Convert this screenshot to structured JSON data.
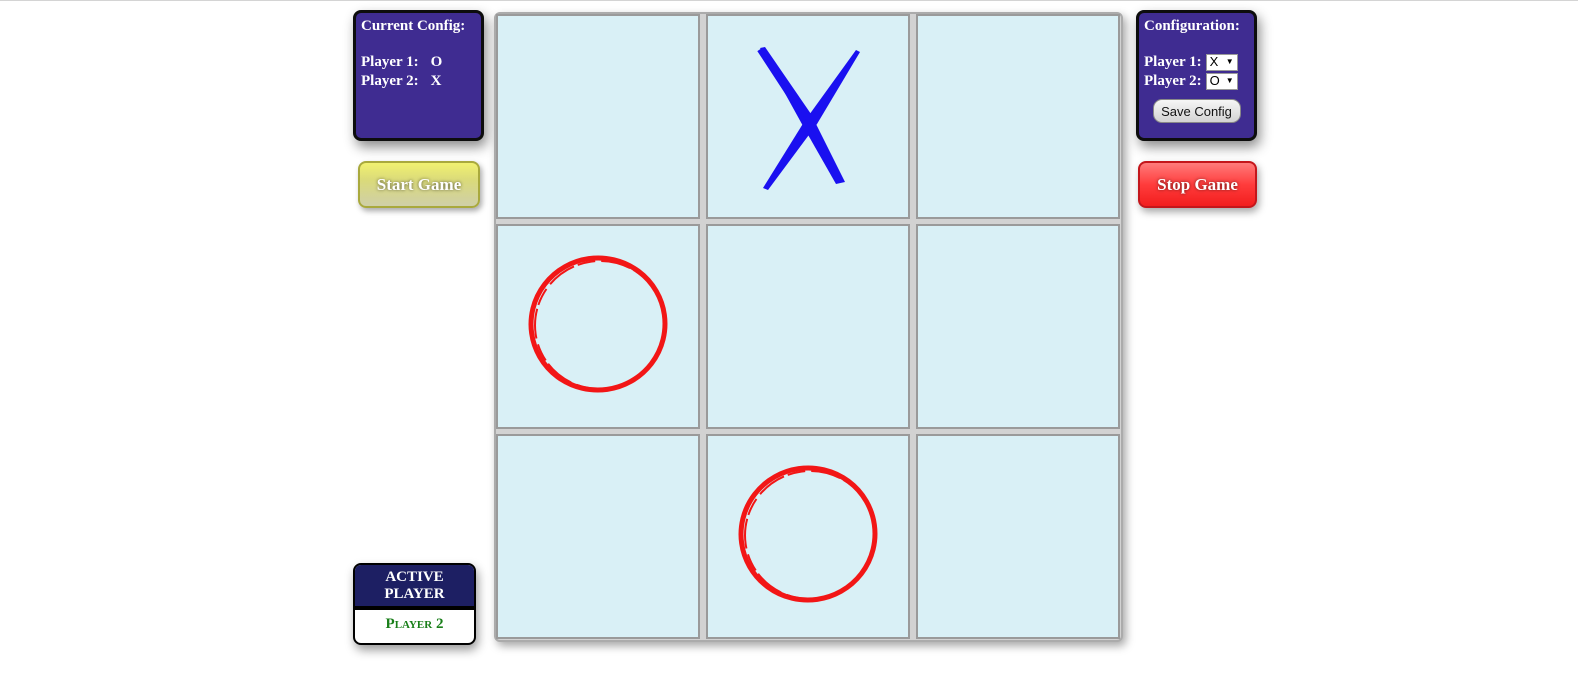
{
  "current_config": {
    "title": "Current Config:",
    "player1_label": "Player 1:",
    "player1_value": "O",
    "player2_label": "Player 2:",
    "player2_value": "X"
  },
  "configuration": {
    "title": "Configuration:",
    "player1_label": "Player 1:",
    "player1_selected": "X",
    "player2_label": "Player 2:",
    "player2_selected": "O",
    "save_label": "Save Config"
  },
  "buttons": {
    "start_label": "Start Game",
    "stop_label": "Stop Game"
  },
  "board": {
    "cells": [
      "",
      "X",
      "",
      "O",
      "",
      "",
      "",
      "O",
      ""
    ],
    "colors": {
      "X": "#1a10f0",
      "O": "#f21616",
      "cell_bg": "#d9f0f6"
    }
  },
  "active_player": {
    "header": "ACTIVE PLAYER",
    "value": "Player 2"
  }
}
